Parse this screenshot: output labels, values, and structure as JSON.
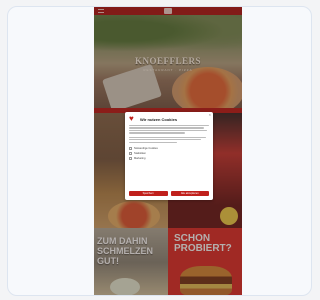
{
  "site": {
    "brand": "KNOEFFLERS",
    "subtitle": "RESTAURANT · PIZZA"
  },
  "tiles": {
    "promo_left": "ZUM DAHIN SCHMELZEN GUT!",
    "promo_right": "SCHON PROBIERT?"
  },
  "cookie_modal": {
    "title": "Wir nutzen Cookies",
    "close_label": "×",
    "options": [
      "Notwendige Cookies",
      "Statistiken",
      "Marketing"
    ],
    "buttons": {
      "accept_all": "Alle akzeptieren",
      "save": "Speichern"
    }
  },
  "colors": {
    "brand_red": "#c0201c",
    "modal_bg": "#ffffff"
  },
  "icons": {
    "modal": "shield-icon",
    "close": "close-icon",
    "menu": "hamburger-icon"
  }
}
